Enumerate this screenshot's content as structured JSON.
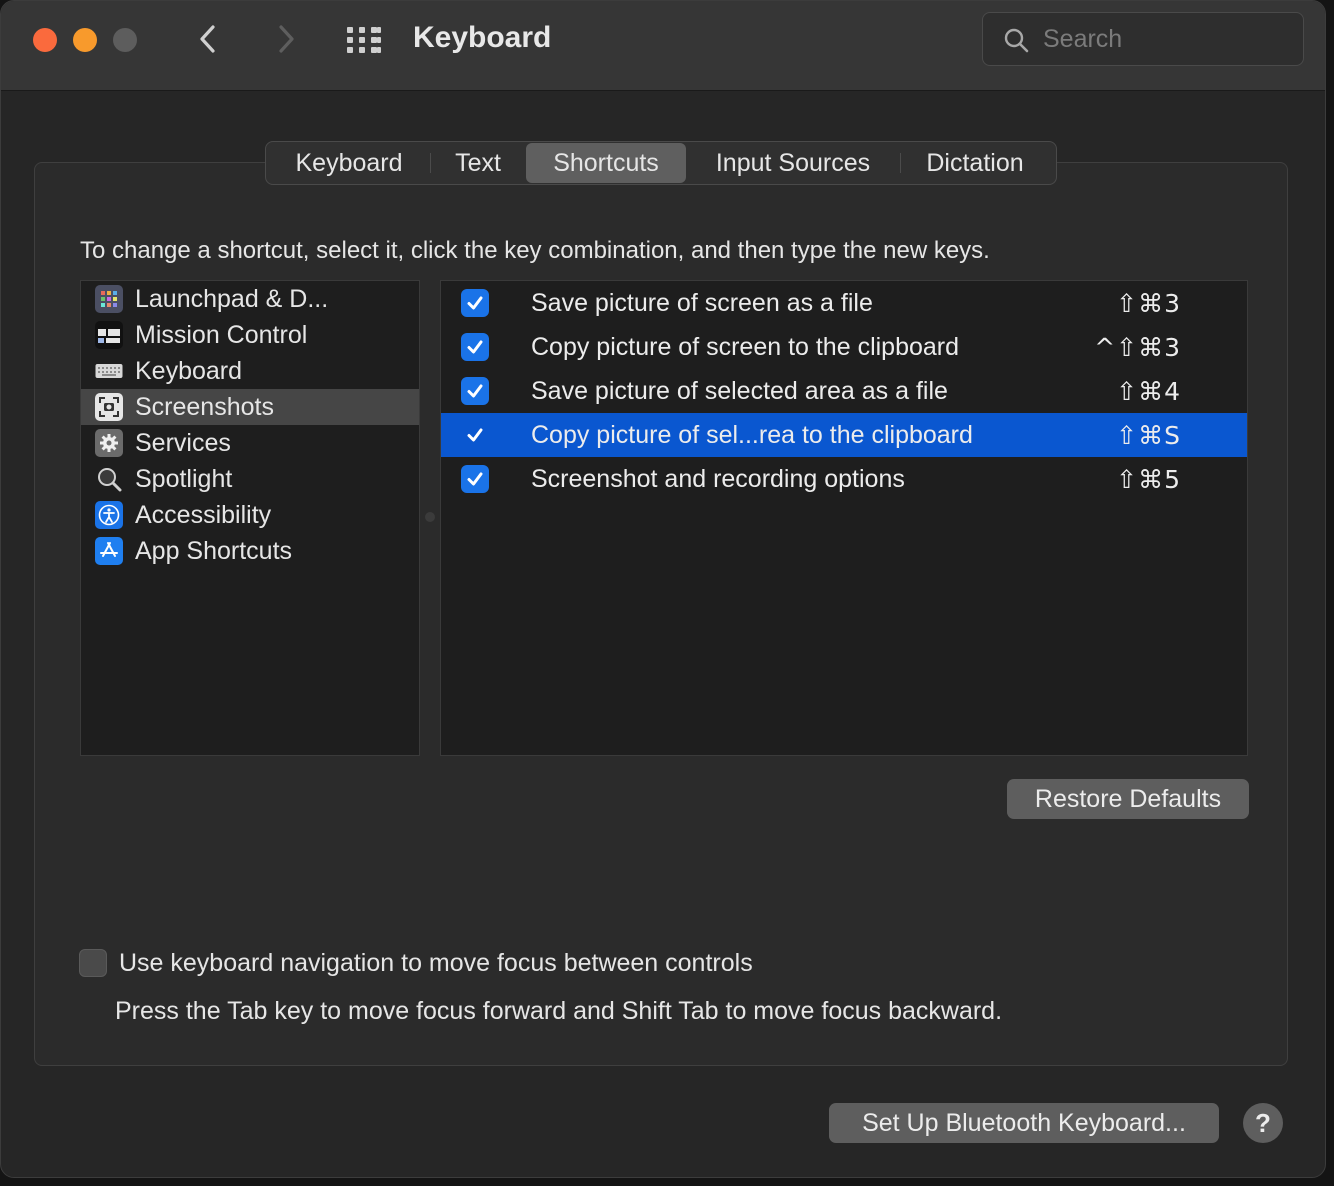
{
  "window": {
    "title": "Keyboard",
    "search": {
      "placeholder": "Search",
      "value": ""
    }
  },
  "tabs": [
    {
      "label": "Keyboard",
      "active": false
    },
    {
      "label": "Text",
      "active": false
    },
    {
      "label": "Shortcuts",
      "active": true
    },
    {
      "label": "Input Sources",
      "active": false
    },
    {
      "label": "Dictation",
      "active": false
    }
  ],
  "instruction": "To change a shortcut, select it, click the key combination, and then type the new keys.",
  "categories": [
    {
      "label": "Launchpad & D...",
      "icon": "launchpad-icon",
      "selected": false
    },
    {
      "label": "Mission Control",
      "icon": "mission-control-icon",
      "selected": false
    },
    {
      "label": "Keyboard",
      "icon": "keyboard-icon",
      "selected": false
    },
    {
      "label": "Screenshots",
      "icon": "screenshot-icon",
      "selected": true
    },
    {
      "label": "Services",
      "icon": "gear-icon",
      "selected": false
    },
    {
      "label": "Spotlight",
      "icon": "spotlight-icon",
      "selected": false
    },
    {
      "label": "Accessibility",
      "icon": "accessibility-icon",
      "selected": false
    },
    {
      "label": "App Shortcuts",
      "icon": "app-store-icon",
      "selected": false
    }
  ],
  "shortcuts": [
    {
      "name": "Save picture of screen as a file",
      "keys": "⇧⌘3",
      "checked": true,
      "selected": false
    },
    {
      "name": "Copy picture of screen to the clipboard",
      "keys": "^⇧⌘3",
      "checked": true,
      "selected": false
    },
    {
      "name": "Save picture of selected area as a file",
      "keys": "⇧⌘4",
      "checked": true,
      "selected": false
    },
    {
      "name": "Copy picture of sel...rea to the clipboard",
      "keys": "⇧⌘S",
      "checked": true,
      "selected": true
    },
    {
      "name": "Screenshot and recording options",
      "keys": "⇧⌘5",
      "checked": true,
      "selected": false
    }
  ],
  "buttons": {
    "restore_defaults": "Restore Defaults",
    "bluetooth": "Set Up Bluetooth Keyboard...",
    "help": "?"
  },
  "keyboard_navigation": {
    "label": "Use keyboard navigation to move focus between controls",
    "help": "Press the Tab key to move focus forward and Shift Tab to move focus backward.",
    "checked": false
  },
  "colors": {
    "accent": "#1a73e8",
    "selection": "#0a57d0",
    "close": "#fa6a3d",
    "minimize": "#f89a2c"
  }
}
